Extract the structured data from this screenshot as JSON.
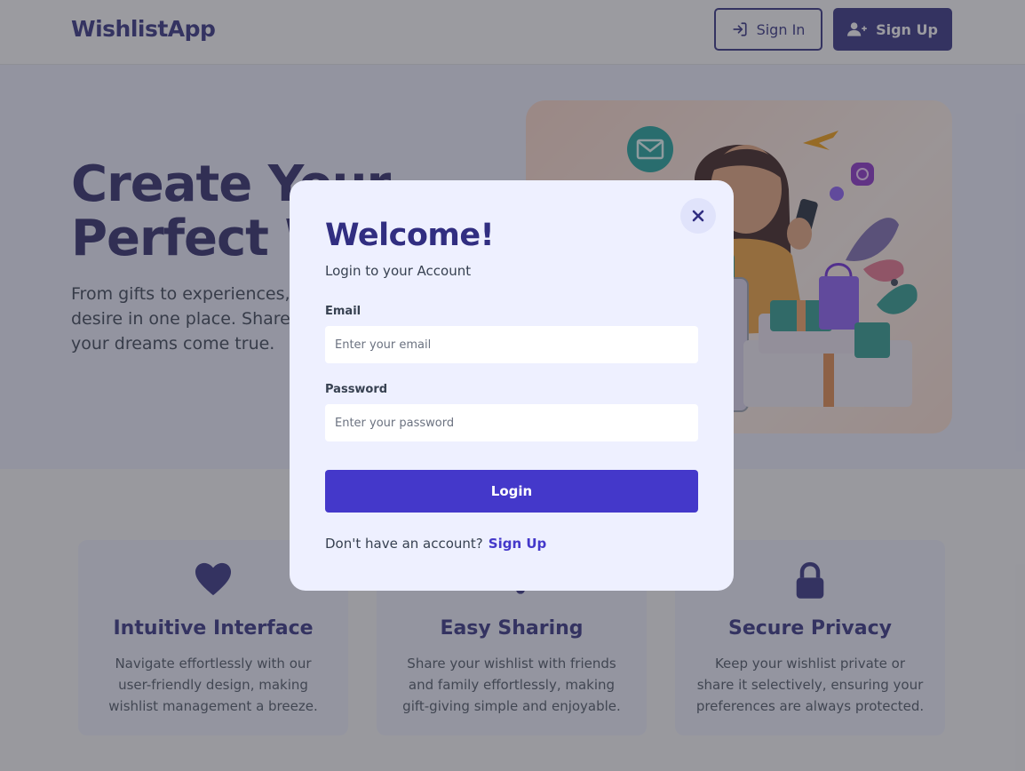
{
  "nav": {
    "logo": "WishlistApp",
    "sign_in_label": "Sign In",
    "sign_up_label": "Sign Up"
  },
  "hero": {
    "title_line1": "Create Your",
    "title_line2": "Perfect W",
    "text": "From gifts to experiences, o desire in one place. Share w your dreams come true.",
    "text_line1": "From gifts to experiences, o",
    "text_line2": "desire in one place. Share w",
    "text_line3": "your dreams come true."
  },
  "features": [
    {
      "icon": "heart-icon",
      "title": "Intuitive Interface",
      "text": "Navigate effortlessly with our user-friendly design, making wishlist management a breeze."
    },
    {
      "icon": "share-icon",
      "title": "Easy Sharing",
      "text": "Share your wishlist with friends and family effortlessly, making gift-giving simple and enjoyable."
    },
    {
      "icon": "lock-icon",
      "title": "Secure Privacy",
      "text": "Keep your wishlist private or share it selectively, ensuring your preferences are always protected."
    }
  ],
  "modal": {
    "title": "Welcome!",
    "subtitle": "Login to your Account",
    "email_label": "Email",
    "email_placeholder": "Enter your email",
    "password_label": "Password",
    "password_placeholder": "Enter your password",
    "login_label": "Login",
    "no_account_text": "Don't have an account?",
    "sign_up_link": "Sign Up"
  },
  "colors": {
    "brand": "#312e81",
    "accent": "#4438ca",
    "modal_bg": "#eef0ff"
  }
}
